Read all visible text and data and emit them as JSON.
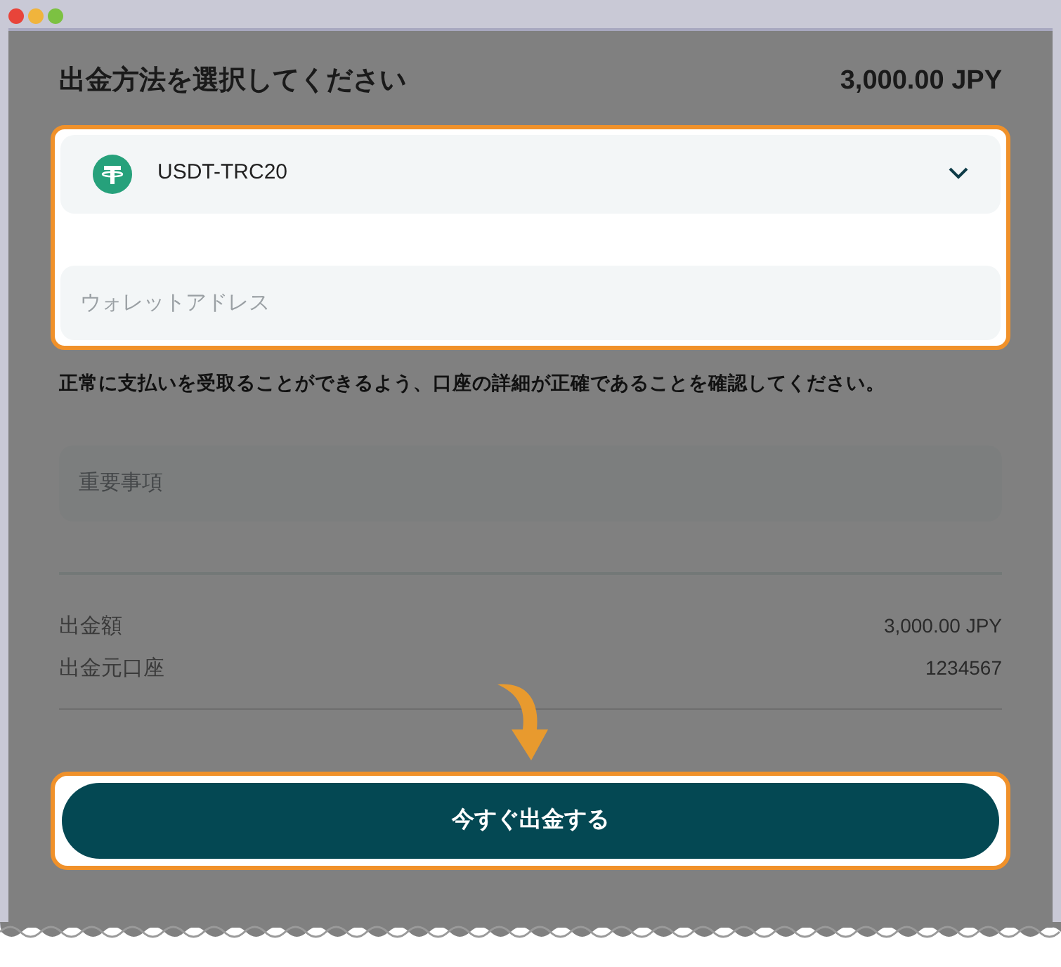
{
  "header": {
    "title": "出金方法を選択してください",
    "total": "3,000.00 JPY"
  },
  "method_select": {
    "value": "USDT-TRC20"
  },
  "wallet_address": {
    "placeholder": "ウォレットアドレス"
  },
  "notice": "正常に支払いを受取ることができるよう、口座の詳細が正確であることを確認してください。",
  "important_field": {
    "placeholder": "重要事項"
  },
  "summary": [
    {
      "label": "出金額",
      "value": "3,000.00 JPY"
    },
    {
      "label": "出金元口座",
      "value": "1234567"
    }
  ],
  "submit_button": "今すぐ出金する"
}
